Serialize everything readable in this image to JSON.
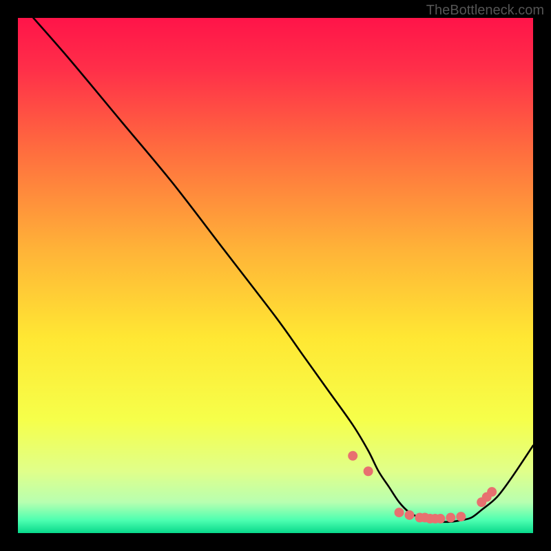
{
  "attribution": "TheBottleneck.com",
  "chart_data": {
    "type": "line",
    "title": "",
    "xlabel": "",
    "ylabel": "",
    "xlim": [
      0,
      100
    ],
    "ylim": [
      0,
      100
    ],
    "curve": {
      "x": [
        3,
        10,
        20,
        30,
        40,
        50,
        55,
        60,
        65,
        68,
        70,
        72,
        74,
        76,
        78,
        80,
        82,
        84,
        86,
        88,
        90,
        93,
        96,
        100
      ],
      "y": [
        100,
        92,
        80,
        68,
        55,
        42,
        35,
        28,
        21,
        16,
        12,
        9,
        6,
        4,
        3,
        2.5,
        2.2,
        2.2,
        2.5,
        3,
        4.5,
        7,
        11,
        17
      ]
    },
    "markers": {
      "x": [
        65,
        68,
        74,
        76,
        78,
        79,
        80,
        81,
        82,
        84,
        86,
        90,
        91,
        92
      ],
      "y": [
        15,
        12,
        4,
        3.5,
        3,
        3,
        2.8,
        2.8,
        2.8,
        3,
        3.2,
        6,
        7,
        8
      ],
      "color": "#e87070",
      "size": 7
    },
    "gradient_stops": [
      {
        "offset": 0.0,
        "color": "#ff1449"
      },
      {
        "offset": 0.1,
        "color": "#ff2f49"
      },
      {
        "offset": 0.25,
        "color": "#ff6a3f"
      },
      {
        "offset": 0.45,
        "color": "#ffb338"
      },
      {
        "offset": 0.62,
        "color": "#ffe733"
      },
      {
        "offset": 0.78,
        "color": "#f6ff4a"
      },
      {
        "offset": 0.88,
        "color": "#e0ff8a"
      },
      {
        "offset": 0.94,
        "color": "#b8ffb0"
      },
      {
        "offset": 0.975,
        "color": "#4dffb0"
      },
      {
        "offset": 1.0,
        "color": "#08d98b"
      }
    ]
  }
}
